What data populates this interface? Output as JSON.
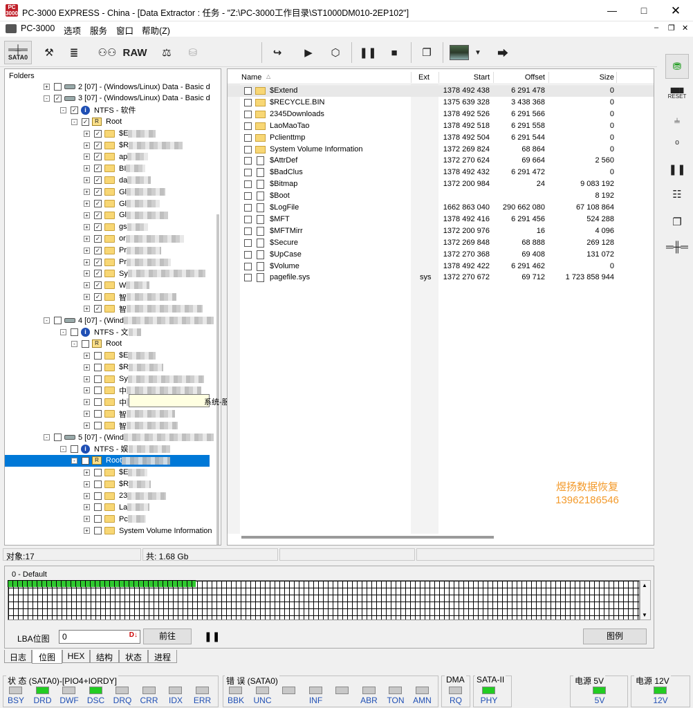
{
  "window": {
    "title": "PC-3000 EXPRESS - China - [Data Extractor : 任务 - \"Z:\\PC-3000工作目录\\ST1000DM010-2EP102\"]",
    "icon_text": "PC\n3000"
  },
  "menu": {
    "items": [
      "PC-3000",
      "选项",
      "服务",
      "窗口",
      "帮助(Z)"
    ]
  },
  "toolbar": {
    "sata_label": "SATA0",
    "raw_label": "RAW"
  },
  "folders": {
    "header": "Folders",
    "rows": [
      {
        "label": "2 [07] - (Windows/Linux) Data - Basic d"
      },
      {
        "label": "3 [07] - (Windows/Linux) Data - Basic d"
      },
      {
        "label": "NTFS - 软件"
      },
      {
        "label": "Root"
      },
      {
        "label": "$E"
      },
      {
        "label": "$R"
      },
      {
        "label": "ap"
      },
      {
        "label": "BI"
      },
      {
        "label": "da"
      },
      {
        "label": "Gl"
      },
      {
        "label": "Gl"
      },
      {
        "label": "Gl"
      },
      {
        "label": "gs"
      },
      {
        "label": "or"
      },
      {
        "label": "Pr"
      },
      {
        "label": "Pr"
      },
      {
        "label": "Sy"
      },
      {
        "label": "W"
      },
      {
        "label": "智"
      },
      {
        "label": "智"
      },
      {
        "label": "4 [07] - (Wind"
      },
      {
        "label": "NTFS - 文"
      },
      {
        "label": "Root"
      },
      {
        "label": "$E"
      },
      {
        "label": "$R"
      },
      {
        "label": "Sy"
      },
      {
        "label": "中"
      },
      {
        "label": "中"
      },
      {
        "label": "智"
      },
      {
        "label": "智"
      },
      {
        "label": "5 [07] - (Wind"
      },
      {
        "label": "NTFS - 娱"
      },
      {
        "label": "Root"
      },
      {
        "label": "$E"
      },
      {
        "label": "$R"
      },
      {
        "label": "23"
      },
      {
        "label": "La"
      },
      {
        "label": "Pc"
      },
      {
        "label": "System Volume Information"
      }
    ],
    "tooltip": "系统-服务端"
  },
  "filelist": {
    "headers": {
      "name": "Name",
      "ext": "Ext",
      "start": "Start",
      "offset": "Offset",
      "size": "Size"
    },
    "rows": [
      {
        "name": "$Extend",
        "ext": "",
        "start": "1378 492 438",
        "offset": "6 291 478",
        "size": "0",
        "type": "folder"
      },
      {
        "name": "$RECYCLE.BIN",
        "ext": "",
        "start": "1375 639 328",
        "offset": "3 438 368",
        "size": "0",
        "type": "folder"
      },
      {
        "name": "2345Downloads",
        "ext": "",
        "start": "1378 492 526",
        "offset": "6 291 566",
        "size": "0",
        "type": "folder"
      },
      {
        "name": "LaoMaoTao",
        "ext": "",
        "start": "1378 492 518",
        "offset": "6 291 558",
        "size": "0",
        "type": "folder"
      },
      {
        "name": "Pclienttmp",
        "ext": "",
        "start": "1378 492 504",
        "offset": "6 291 544",
        "size": "0",
        "type": "folder"
      },
      {
        "name": "System Volume Information",
        "ext": "",
        "start": "1372 269 824",
        "offset": "68 864",
        "size": "0",
        "type": "folder"
      },
      {
        "name": "$AttrDef",
        "ext": "",
        "start": "1372 270 624",
        "offset": "69 664",
        "size": "2 560",
        "type": "file"
      },
      {
        "name": "$BadClus",
        "ext": "",
        "start": "1378 492 432",
        "offset": "6 291 472",
        "size": "0",
        "type": "file"
      },
      {
        "name": "$Bitmap",
        "ext": "",
        "start": "1372 200 984",
        "offset": "24",
        "size": "9 083 192",
        "type": "file"
      },
      {
        "name": "$Boot",
        "ext": "",
        "start": "",
        "offset": "",
        "size": "8 192",
        "type": "file"
      },
      {
        "name": "$LogFile",
        "ext": "",
        "start": "1662 863 040",
        "offset": "290 662 080",
        "size": "67 108 864",
        "type": "file"
      },
      {
        "name": "$MFT",
        "ext": "",
        "start": "1378 492 416",
        "offset": "6 291 456",
        "size": "524 288",
        "type": "file"
      },
      {
        "name": "$MFTMirr",
        "ext": "",
        "start": "1372 200 976",
        "offset": "16",
        "size": "4 096",
        "type": "file"
      },
      {
        "name": "$Secure",
        "ext": "",
        "start": "1372 269 848",
        "offset": "68 888",
        "size": "269 128",
        "type": "file"
      },
      {
        "name": "$UpCase",
        "ext": "",
        "start": "1372 270 368",
        "offset": "69 408",
        "size": "131 072",
        "type": "file"
      },
      {
        "name": "$Volume",
        "ext": "",
        "start": "1378 492 422",
        "offset": "6 291 462",
        "size": "0",
        "type": "file"
      },
      {
        "name": "pagefile.sys",
        "ext": "sys",
        "start": "1372 270 672",
        "offset": "69 712",
        "size": "1 723 858 944",
        "type": "file"
      }
    ],
    "watermark_line1": "煜扬数据恢复",
    "watermark_line2": "13962186546",
    "watermark_color": "#f39a2b"
  },
  "status": {
    "objects": "对象:17",
    "total": "共: 1.68 Gb"
  },
  "bitmap": {
    "title": "0 - Default",
    "lba_label": "LBA位图",
    "lba_value": "0",
    "goto_label": "前往",
    "legend_label": "图例"
  },
  "tabs": [
    "日志",
    "位图",
    "HEX",
    "结构",
    "状态",
    "进程"
  ],
  "indicators": {
    "state_title": "状 态 (SATA0)-[PIO4+IORDY]",
    "state_leds": [
      {
        "label": "BSY",
        "on": false
      },
      {
        "label": "DRD",
        "on": true
      },
      {
        "label": "DWF",
        "on": false
      },
      {
        "label": "DSC",
        "on": true
      },
      {
        "label": "DRQ",
        "on": false
      },
      {
        "label": "CRR",
        "on": false
      },
      {
        "label": "IDX",
        "on": false
      },
      {
        "label": "ERR",
        "on": false
      }
    ],
    "error_title": "错 误 (SATA0)",
    "error_leds": [
      {
        "label": "BBK",
        "on": false
      },
      {
        "label": "UNC",
        "on": false
      },
      {
        "label": "",
        "on": false
      },
      {
        "label": "INF",
        "on": false
      },
      {
        "label": "",
        "on": false
      },
      {
        "label": "ABR",
        "on": false
      },
      {
        "label": "TON",
        "on": false
      },
      {
        "label": "AMN",
        "on": false
      }
    ],
    "dma_title": "DMA",
    "dma_label": "RQ",
    "sata_title": "SATA-II",
    "sata_label": "PHY",
    "power5_title": "电源 5V",
    "power5_label": "5V",
    "power12_title": "电源 12V",
    "power12_label": "12V"
  },
  "colors": {
    "selection": "#0078d7",
    "led_on": "#22cc22",
    "led_label": "#1f4fb4"
  }
}
